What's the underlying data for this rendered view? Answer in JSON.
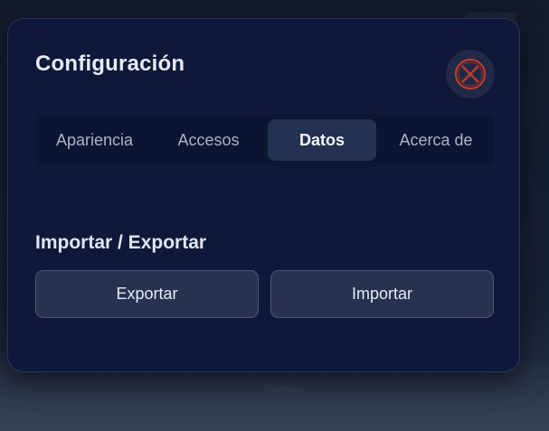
{
  "dialog": {
    "title": "Configuración",
    "close_icon": "close-circle-icon",
    "accent_close": "#c0392b"
  },
  "tabs": [
    {
      "label": "Apariencia",
      "active": false
    },
    {
      "label": "Accesos",
      "active": false
    },
    {
      "label": "Datos",
      "active": true
    },
    {
      "label": "Acerca de",
      "active": false
    }
  ],
  "data_section": {
    "title": "Importar / Exportar",
    "export_label": "Exportar",
    "import_label": "Importar"
  },
  "backdrop": {
    "faint_text": "Nuevo"
  }
}
